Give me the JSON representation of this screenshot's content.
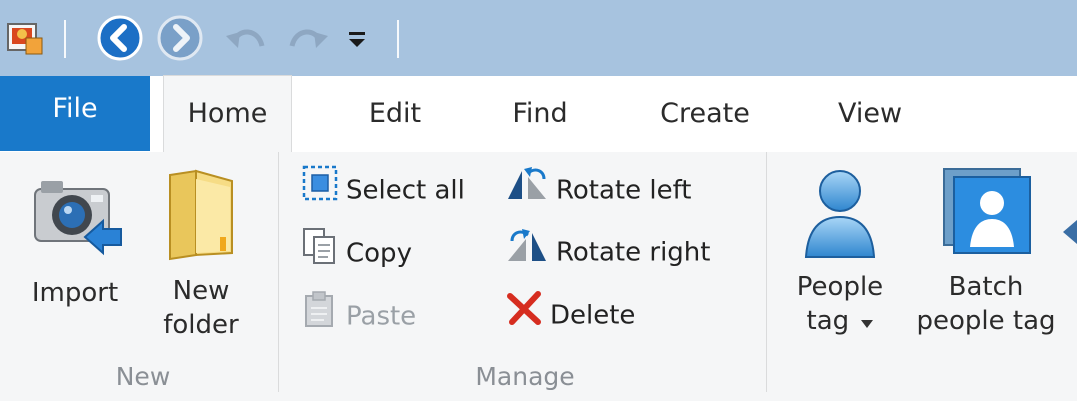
{
  "quick_access": {
    "icons": [
      "app-photo-icon",
      "back-icon",
      "forward-icon",
      "undo-icon",
      "redo-icon",
      "customize-dropdown-icon"
    ]
  },
  "tabs": [
    {
      "label": "File"
    },
    {
      "label": "Home"
    },
    {
      "label": "Edit"
    },
    {
      "label": "Find"
    },
    {
      "label": "Create"
    },
    {
      "label": "View"
    }
  ],
  "groups": {
    "new": {
      "label": "New",
      "import": "Import",
      "new_folder_line1": "New",
      "new_folder_line2": "folder"
    },
    "manage": {
      "label": "Manage",
      "select_all": "Select all",
      "copy": "Copy",
      "paste": "Paste",
      "rotate_left": "Rotate left",
      "rotate_right": "Rotate right",
      "delete": "Delete"
    },
    "people": {
      "people_tag_line1": "People",
      "people_tag_line2": "tag",
      "batch_line1": "Batch",
      "batch_line2": "people tag"
    }
  },
  "colors": {
    "titlebar": "#a7c3df",
    "file_tab": "#1979ca",
    "delete_red": "#d62d20",
    "accent_blue": "#1979ca"
  }
}
